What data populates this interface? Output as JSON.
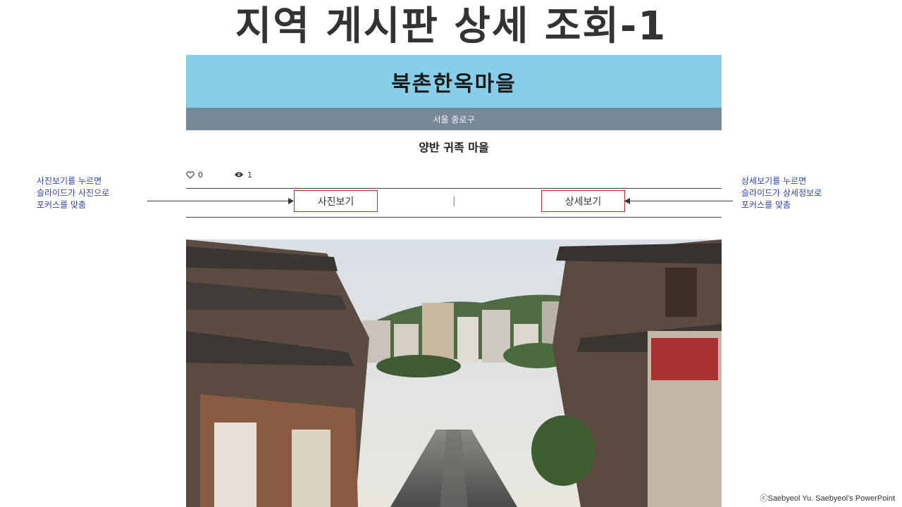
{
  "slide": {
    "title": "지역 게시판 상세 조회-1",
    "copyright": "ⓒSaebyeol Yu. Saebyeol's PowerPoint"
  },
  "post": {
    "place_name": "북촌한옥마을",
    "region": "서울 종로구",
    "subtitle": "양반 귀족 마을",
    "likes": "0",
    "views": "1"
  },
  "tabs": {
    "photo_label": "사진보기",
    "separator": "|",
    "detail_label": "상세보기"
  },
  "notes": {
    "left": [
      "사진보기를 누르면",
      "슬라이드가 사진으로",
      "포커스를 맞춤"
    ],
    "right": [
      "상세보기를 누르면",
      "슬라이드가 상세정보로",
      "포커스를 맞춤"
    ]
  },
  "colors": {
    "header_bg": "#87ceeb",
    "region_bg": "#778899",
    "tab_border": "#cc2222",
    "note_text": "#3344aa"
  },
  "icons": {
    "likes": "heart-icon",
    "views": "eye-icon"
  }
}
